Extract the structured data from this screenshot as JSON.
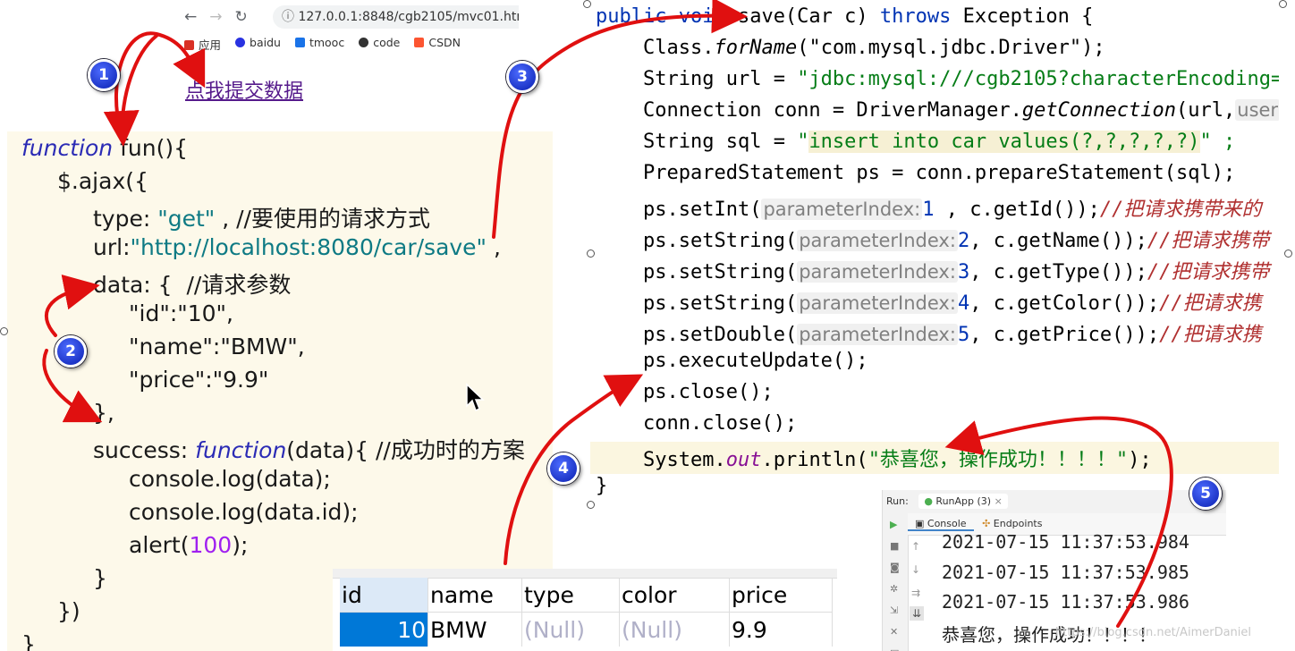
{
  "browser": {
    "nav_icons": [
      "back-icon",
      "forward-icon",
      "reload-icon",
      "info-icon"
    ],
    "url": "127.0.0.1:8848/cgb2105/mvc01.html",
    "bookmarks": [
      {
        "label": "应用",
        "color": "#d93025"
      },
      {
        "label": "baidu",
        "color": "#2932e1"
      },
      {
        "label": "tmooc",
        "color": "#1a73e8"
      },
      {
        "label": "code",
        "color": "#333333"
      },
      {
        "label": "CSDN",
        "color": "#fc5531"
      }
    ]
  },
  "link_text": "点我提交数据",
  "js_code": {
    "l1_kw": "function",
    "l1_rest": " fun(){",
    "l2": "$.ajax({",
    "l3_key": "type: ",
    "l3_val": "\"get\"",
    "l3_cm": " , //要使用的请求方式",
    "l4_key": "url:",
    "l4_val": "\"http://localhost:8080/car/save\"",
    "l4_end": " ,",
    "l5_key": "data: { ",
    "l5_cm": " //请求参数",
    "l6": "\"id\":\"10\",",
    "l7": "\"name\":\"BMW\",",
    "l8": "\"price\":\"9.9\"",
    "l9": "},",
    "l10_key": "success: ",
    "l10_kw": "function",
    "l10_rest": "(data){ //成功时的方案",
    "l11": "console.log(data);",
    "l12": "console.log(data.id);",
    "l13_a": "alert(",
    "l13_num": "100",
    "l13_b": ");",
    "l14": "}",
    "l15": "})",
    "l16": "}"
  },
  "java_code": {
    "sig_a": "public void ",
    "sig_b": "save(Car c) ",
    "sig_c": "throws ",
    "sig_d": "Exception {",
    "l2_a": "Class.",
    "l2_m": "forName",
    "l2_s": "(\"com.mysql.jdbc.Driver\");",
    "l3_a": "String url = ",
    "l3_s": "\"jdbc:mysql:///cgb2105?characterEncoding=",
    "l4_a": "Connection conn = DriverManager.",
    "l4_m": "getConnection",
    "l4_b": "(url,",
    "l4_h": "user",
    "l5_a": "String sql = ",
    "l5_q": "\"",
    "l5_sql": "insert into car values(?,?,?,?,?)",
    "l5_e": "\" ;",
    "l6": "PreparedStatement ps = conn.prepareStatement(sql);",
    "hint": "parameterIndex:",
    "set_rows": [
      {
        "call": "ps.setInt(",
        "idx": "1",
        "rest": " , c.getId());",
        "comment": "//把请求携带来的"
      },
      {
        "call": "ps.setString(",
        "idx": "2",
        "rest": ", c.getName());",
        "comment": "//把请求携带"
      },
      {
        "call": "ps.setString(",
        "idx": "3",
        "rest": ", c.getType());",
        "comment": "//把请求携带"
      },
      {
        "call": "ps.setString(",
        "idx": "4",
        "rest": ", c.getColor());",
        "comment": "//把请求携"
      },
      {
        "call": "ps.setDouble(",
        "idx": "5",
        "rest": ", c.getPrice());",
        "comment": "//把请求携"
      }
    ],
    "l12": "ps.executeUpdate();",
    "l13": "ps.close();",
    "l14": "conn.close();",
    "l15_a": "System.",
    "l15_o": "out",
    "l15_b": ".println(",
    "l15_s": "\"恭喜您，操作成功！！！！\"",
    "l15_e": ");",
    "l16": "}"
  },
  "table": {
    "headers": [
      "id",
      "name",
      "type",
      "color",
      "price"
    ],
    "row": [
      "10",
      "BMW",
      "(Null)",
      "(Null)",
      "9.9"
    ]
  },
  "run": {
    "title": "Run:",
    "config": "RunApp (3)",
    "tabs": [
      "Console",
      "Endpoints"
    ],
    "lines": [
      "2021-07-15 11:37:53.984",
      "2021-07-15 11:37:53.985",
      "2021-07-15 11:37:53.986",
      "恭喜您，操作成功！！！！"
    ]
  },
  "badges": [
    "1",
    "2",
    "3",
    "4",
    "5"
  ],
  "watermark": "https://blog.csdn.net/AimerDaniel",
  "colors": {
    "arrow": "#e01010",
    "badge": "#1a3fe0"
  }
}
